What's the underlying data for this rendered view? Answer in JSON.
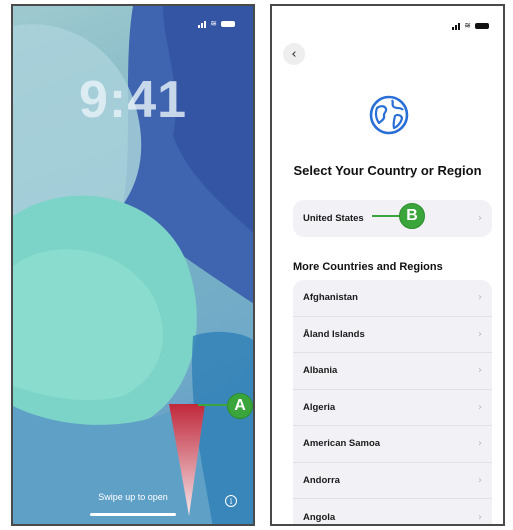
{
  "lock_screen": {
    "time": "9:41",
    "swipe_hint": "Swipe up to open",
    "info_icon": "i"
  },
  "setup_screen": {
    "back_icon": "‹",
    "title": "Select Your Country or Region",
    "selected_country": "United States",
    "section_header": "More Countries and Regions",
    "countries": [
      "Afghanistan",
      "Åland Islands",
      "Albania",
      "Algeria",
      "American Samoa",
      "Andorra",
      "Angola"
    ],
    "chevron": "›"
  },
  "callouts": {
    "a": "A",
    "b": "B"
  },
  "colors": {
    "callout_green": "#3aa53a",
    "arrow_red": "#c0283a"
  },
  "icons": [
    "signal-icon",
    "wifi-icon",
    "battery-icon",
    "globe-icon",
    "chevron-right-icon",
    "info-icon",
    "back-chevron-icon"
  ]
}
